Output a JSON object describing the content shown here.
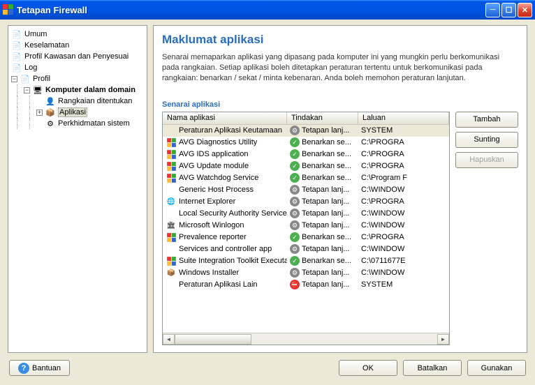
{
  "window": {
    "title": "Tetapan Firewall"
  },
  "tree": {
    "items": [
      {
        "label": "Umum",
        "icon": "📄",
        "depth": 0
      },
      {
        "label": "Keselamatan",
        "icon": "📄",
        "depth": 0
      },
      {
        "label": "Profil Kawasan dan Penyesuai",
        "icon": "📄",
        "depth": 0
      },
      {
        "label": "Log",
        "icon": "📄",
        "depth": 0
      },
      {
        "label": "Profil",
        "icon": "📄",
        "depth": 0,
        "toggle": "−"
      },
      {
        "label": "Komputer dalam domain",
        "icon": "🖥",
        "depth": 1,
        "toggle": "−",
        "bold": true
      },
      {
        "label": "Rangkaian ditentukan",
        "icon": "👤",
        "depth": 2
      },
      {
        "label": "Aplikasi",
        "icon": "📦",
        "depth": 2,
        "toggle": "+",
        "selected": true
      },
      {
        "label": "Perkhidmatan sistem",
        "icon": "⚙",
        "depth": 2
      }
    ]
  },
  "panel": {
    "heading": "Maklumat aplikasi",
    "desc": "Senarai memaparkan aplikasi yang dipasang pada komputer ini yang mungkin perlu berkomunikasi pada rangkaian. Setiap aplikasi boleh ditetapkan peraturan tertentu untuk berkomunikasi pada rangkaian: benarkan / sekat / minta kebenaran. Anda boleh memohon peraturan lanjutan.",
    "list_label": "Senarai aplikasi",
    "columns": {
      "name": "Nama aplikasi",
      "action": "Tindakan",
      "path": "Laluan"
    },
    "rows": [
      {
        "name": "Peraturan Aplikasi Keutamaan",
        "icon": "",
        "iconbg": "",
        "act": "gear",
        "action": "Tetapan lanj...",
        "path": "SYSTEM",
        "selected": true
      },
      {
        "name": "AVG Diagnostics Utility",
        "icon": "avg",
        "act": "allow",
        "action": "Benarkan se...",
        "path": "C:\\PROGRA"
      },
      {
        "name": "AVG IDS application",
        "icon": "avg",
        "act": "allow",
        "action": "Benarkan se...",
        "path": "C:\\PROGRA"
      },
      {
        "name": "AVG Update module",
        "icon": "avg",
        "act": "allow",
        "action": "Benarkan se...",
        "path": "C:\\PROGRA"
      },
      {
        "name": "AVG Watchdog Service",
        "icon": "avg",
        "act": "allow",
        "action": "Benarkan se...",
        "path": "C:\\Program F"
      },
      {
        "name": "Generic Host Process",
        "icon": "",
        "act": "gear",
        "action": "Tetapan lanj...",
        "path": "C:\\WINDOW"
      },
      {
        "name": "Internet Explorer",
        "icon": "🌐",
        "act": "gear",
        "action": "Tetapan lanj...",
        "path": "C:\\PROGRA"
      },
      {
        "name": "Local Security Authority Service",
        "icon": "",
        "act": "gear",
        "action": "Tetapan lanj...",
        "path": "C:\\WINDOW"
      },
      {
        "name": "Microsoft Winlogon",
        "icon": "🏛",
        "act": "gear",
        "action": "Tetapan lanj...",
        "path": "C:\\WINDOW"
      },
      {
        "name": "Prevalence reporter",
        "icon": "avg",
        "act": "allow",
        "action": "Benarkan se...",
        "path": "C:\\PROGRA"
      },
      {
        "name": "Services and controller app",
        "icon": "",
        "act": "gear",
        "action": "Tetapan lanj...",
        "path": "C:\\WINDOW"
      },
      {
        "name": "Suite Integration Toolkit Executable",
        "icon": "avg",
        "act": "allow",
        "action": "Benarkan se...",
        "path": "C:\\0711677E"
      },
      {
        "name": "Windows Installer",
        "icon": "📦",
        "act": "gear",
        "action": "Tetapan lanj...",
        "path": "C:\\WINDOW"
      },
      {
        "name": "Peraturan Aplikasi Lain",
        "icon": "",
        "act": "block",
        "action": "Tetapan lanj...",
        "path": "SYSTEM"
      }
    ],
    "buttons": {
      "add": "Tambah",
      "edit": "Sunting",
      "delete": "Hapuskan"
    }
  },
  "bottom": {
    "help": "Bantuan",
    "ok": "OK",
    "cancel": "Batalkan",
    "apply": "Gunakan"
  }
}
